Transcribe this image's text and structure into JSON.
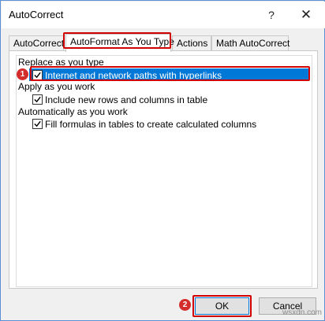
{
  "window": {
    "title": "AutoCorrect",
    "help_label": "?",
    "close_label": "✕"
  },
  "tabs": [
    {
      "label": "AutoCorrect",
      "active": false
    },
    {
      "label": "AutoFormat As You Type",
      "active": true
    },
    {
      "label": "Actions",
      "active": false
    },
    {
      "label": "Math AutoCorrect",
      "active": false
    }
  ],
  "sections": {
    "replace": {
      "label": "Replace as you type",
      "option": {
        "label": "Internet and network paths with hyperlinks",
        "checked": true,
        "selected": true
      }
    },
    "apply": {
      "label": "Apply as you work",
      "option": {
        "label": "Include new rows and columns in table",
        "checked": true
      }
    },
    "automatic": {
      "label": "Automatically as you work",
      "option": {
        "label": "Fill formulas in tables to create calculated columns",
        "checked": true
      }
    }
  },
  "badges": {
    "step1": "1",
    "step2": "2"
  },
  "buttons": {
    "ok_label": "OK",
    "cancel_label": "Cancel"
  },
  "watermark": "wsxdn.com",
  "colors": {
    "highlight": "#d00000",
    "selection": "#0078d7",
    "badge": "#d42b2b"
  }
}
